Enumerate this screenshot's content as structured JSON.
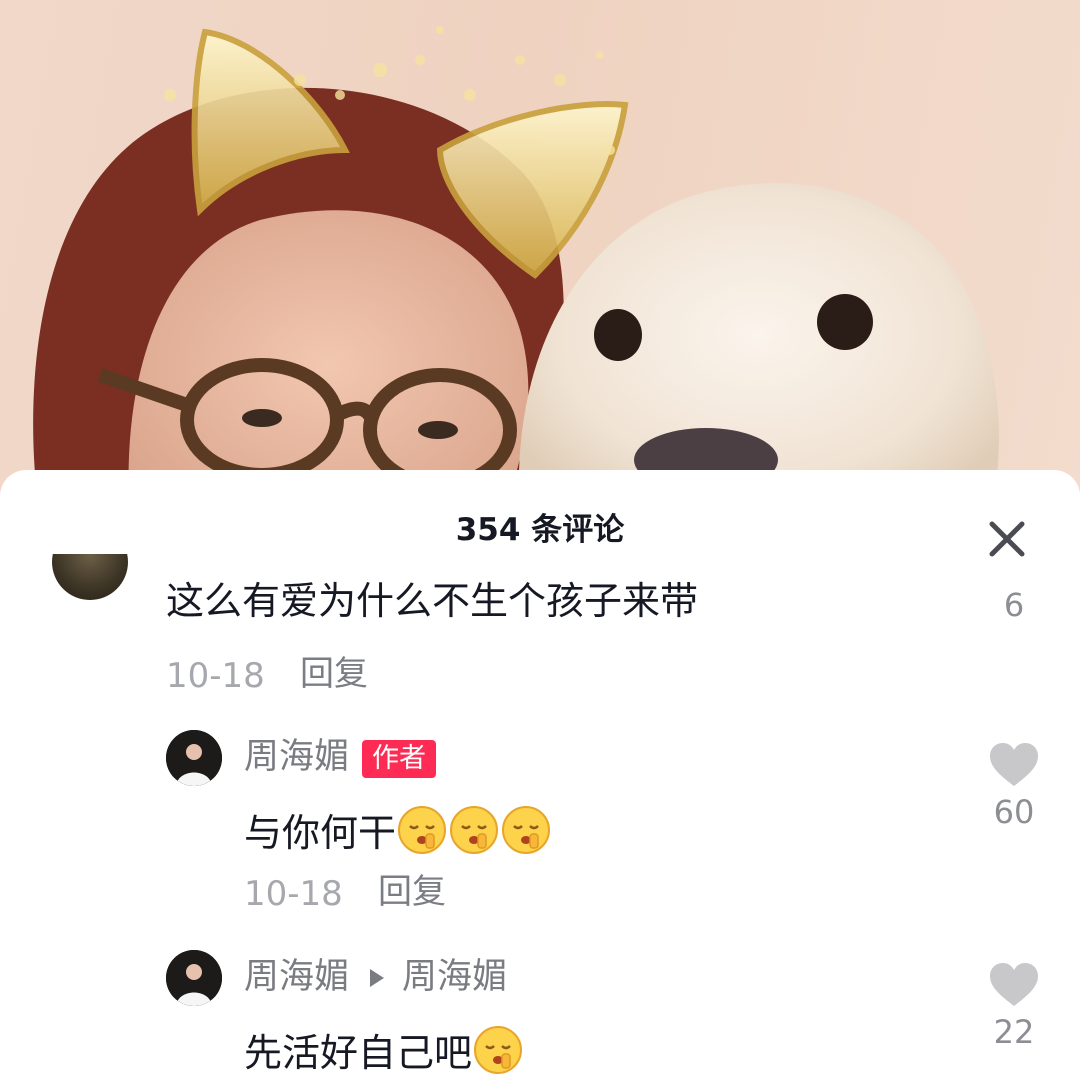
{
  "sheet": {
    "title": "354 条评论"
  },
  "comments": [
    {
      "text": "这么有爱为什么不生个孩子来带",
      "date": "10-18",
      "reply_label": "回复",
      "likes": "6"
    }
  ],
  "replies": [
    {
      "username": "周海媚",
      "author_tag": "作者",
      "text": "与你何干",
      "emoji": [
        "shush-face-emoji",
        "shush-face-emoji",
        "shush-face-emoji"
      ],
      "date": "10-18",
      "reply_label": "回复",
      "likes": "60"
    },
    {
      "username": "周海媚",
      "reply_to": "周海媚",
      "text": "先活好自己吧",
      "emoji": [
        "shush-face-emoji"
      ],
      "likes": "22"
    }
  ],
  "colors": {
    "accent": "#fe2c55",
    "text_primary": "#161823",
    "text_secondary": "#a6a8ad",
    "heart": "#c8c8cb"
  },
  "icons": {
    "close": "close-icon",
    "like": "heart-icon",
    "reply_arrow": "triangle-right-icon"
  }
}
